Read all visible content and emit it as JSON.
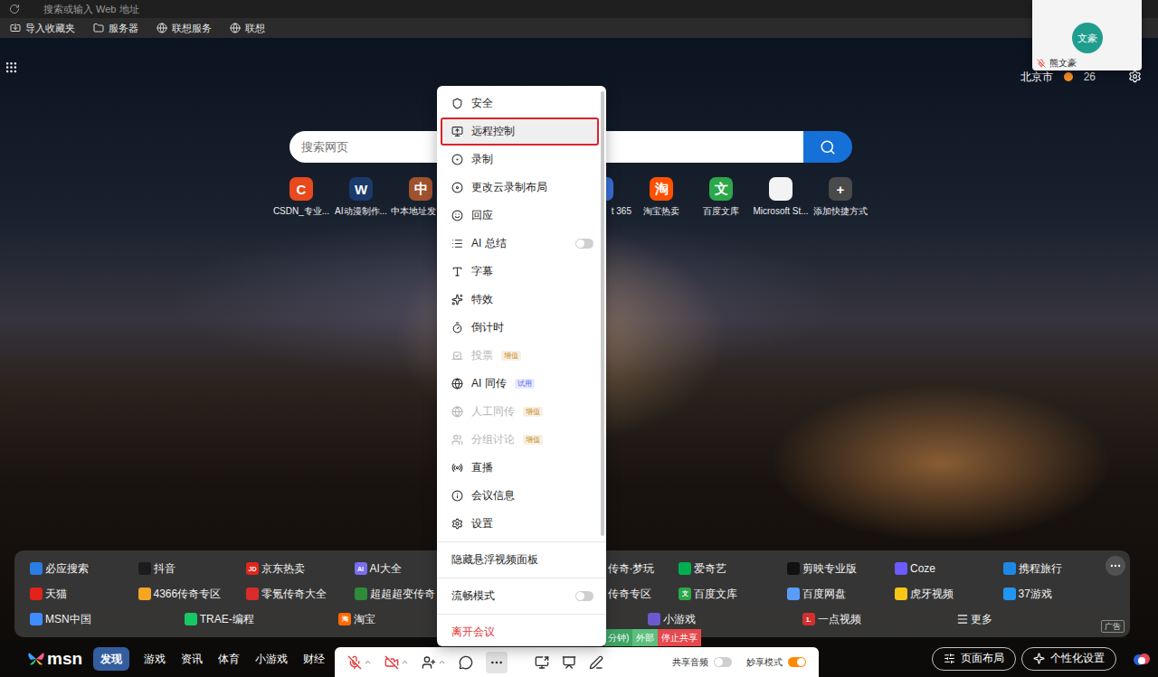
{
  "browser": {
    "address_placeholder": "搜索或输入 Web 地址",
    "bookmarks": [
      {
        "label": "导入收藏夹"
      },
      {
        "label": "服务器"
      },
      {
        "label": "联想服务"
      },
      {
        "label": "联想"
      }
    ]
  },
  "weather": {
    "city": "北京市",
    "temperature": "26"
  },
  "search": {
    "placeholder": "搜索网页"
  },
  "shortcuts": {
    "left": [
      {
        "label": "CSDN_专业...",
        "glyph": "C",
        "color": "#e8491d",
        "kind": "full"
      },
      {
        "label": "AI动漫制作...",
        "glyph": "W",
        "color": "#1b3a6b",
        "kind": "full"
      },
      {
        "label": "中本地址发",
        "glyph": "中",
        "color": "#a0522d",
        "kind": "cut-right"
      }
    ],
    "right": [
      {
        "label": "t 365",
        "glyph": "",
        "color": "#3a6fd8",
        "kind": "cut-left"
      },
      {
        "label": "淘宝热卖",
        "glyph": "淘",
        "color": "#ff5000",
        "kind": "full"
      },
      {
        "label": "百度文库",
        "glyph": "文",
        "color": "#2ba84a",
        "kind": "full"
      },
      {
        "label": "Microsoft St...",
        "glyph": "",
        "color": "#f3f3f3",
        "kind": "full"
      },
      {
        "label": "添加快捷方式",
        "glyph": "+",
        "color": "#4a4a4a",
        "kind": "full"
      }
    ]
  },
  "links": {
    "rows": [
      {
        "left": [
          {
            "label": "必应搜索",
            "glyph": "",
            "color": "#2a7de1",
            "kind": "app"
          },
          {
            "label": "抖音",
            "glyph": "",
            "color": "#1c1c1c",
            "kind": "app"
          },
          {
            "label": "京东热卖",
            "glyph": "JD",
            "color": "#e1251b",
            "kind": "app"
          },
          {
            "label": "AI大全",
            "glyph": "AI",
            "color": "#7a6df2",
            "kind": "app"
          }
        ],
        "right": [
          {
            "label": "传奇·梦玩",
            "kind": "cut"
          },
          {
            "label": "爱奇艺",
            "glyph": "",
            "color": "#00b050",
            "kind": "app"
          },
          {
            "label": "剪映专业版",
            "glyph": "",
            "color": "#111111",
            "kind": "app"
          },
          {
            "label": "Coze",
            "glyph": "",
            "color": "#6b5cff",
            "kind": "app"
          },
          {
            "label": "携程旅行",
            "glyph": "",
            "color": "#1e88e5",
            "kind": "app"
          }
        ]
      },
      {
        "left": [
          {
            "label": "天猫",
            "glyph": "",
            "color": "#e2231a",
            "kind": "app"
          },
          {
            "label": "4366传奇专区",
            "glyph": "",
            "color": "#f5a623",
            "kind": "app"
          },
          {
            "label": "零氪传奇大全",
            "glyph": "",
            "color": "#d92b2b",
            "kind": "app"
          },
          {
            "label": "超超超变传奇",
            "glyph": "",
            "color": "#2e8b3a",
            "kind": "app"
          }
        ],
        "right": [
          {
            "label": "传奇专区",
            "kind": "cut"
          },
          {
            "label": "百度文库",
            "glyph": "文",
            "color": "#2ba84a",
            "kind": "app"
          },
          {
            "label": "百度网盘",
            "glyph": "",
            "color": "#5a9cf8",
            "kind": "app"
          },
          {
            "label": "虎牙视频",
            "glyph": "",
            "color": "#f5c518",
            "kind": "app"
          },
          {
            "label": "37游戏",
            "glyph": "",
            "color": "#2196f3",
            "kind": "app"
          }
        ]
      },
      {
        "left": [
          {
            "label": "MSN中国",
            "glyph": "",
            "color": "#3f8cff",
            "kind": "app"
          },
          {
            "label": "TRAE-编程",
            "glyph": "",
            "color": "#17c964",
            "kind": "app"
          },
          {
            "label": "淘宝",
            "glyph": "淘",
            "color": "#ff6a00",
            "kind": "app"
          }
        ],
        "right": [
          {
            "label": "小游戏",
            "glyph": "",
            "color": "#6a5acd",
            "kind": "app"
          },
          {
            "label": "一点视频",
            "glyph": "1.",
            "color": "#d32f2f",
            "kind": "app"
          },
          {
            "label": "更多",
            "kind": "more"
          }
        ]
      }
    ],
    "ad_label": "广告"
  },
  "nav": {
    "logo": "msn",
    "items": [
      {
        "label": "发现",
        "selected": true
      },
      {
        "label": "游戏",
        "selected": false
      },
      {
        "label": "资讯",
        "selected": false
      },
      {
        "label": "体育",
        "selected": false
      },
      {
        "label": "小游戏",
        "selected": false
      },
      {
        "label": "财经",
        "selected": false
      }
    ],
    "buttons": [
      {
        "label": "页面布局"
      },
      {
        "label": "个性化设置"
      }
    ]
  },
  "video_panel": {
    "avatar": "文豪",
    "name": "熊文豪",
    "mic_muted": true
  },
  "menu": {
    "sections": [
      [
        {
          "label": "安全",
          "kind": "item",
          "selected": false,
          "disabled": false
        },
        {
          "label": "远程控制",
          "kind": "item",
          "selected": true,
          "disabled": false
        },
        {
          "label": "录制",
          "kind": "item",
          "selected": false,
          "disabled": false
        },
        {
          "label": "更改云录制布局",
          "kind": "item",
          "selected": false,
          "disabled": false
        },
        {
          "label": "回应",
          "kind": "item",
          "selected": false,
          "disabled": false
        },
        {
          "label": "AI 总结",
          "kind": "toggle",
          "selected": false,
          "disabled": false,
          "on": false
        },
        {
          "label": "字幕",
          "kind": "item",
          "selected": false,
          "disabled": false
        },
        {
          "label": "特效",
          "kind": "item",
          "selected": false,
          "disabled": false
        },
        {
          "label": "倒计时",
          "kind": "item",
          "selected": false,
          "disabled": false
        },
        {
          "label": "投票",
          "kind": "item",
          "selected": false,
          "disabled": true,
          "badge": "增值",
          "badge_color": "#c8912a"
        },
        {
          "label": "AI 同传",
          "kind": "item",
          "selected": false,
          "disabled": false,
          "badge": "试用",
          "badge_color": "#5865f2"
        },
        {
          "label": "人工同传",
          "kind": "item",
          "selected": false,
          "disabled": true,
          "badge": "增值",
          "badge_color": "#c8912a"
        },
        {
          "label": "分组讨论",
          "kind": "item",
          "selected": false,
          "disabled": true,
          "badge": "增值",
          "badge_color": "#c8912a"
        },
        {
          "label": "直播",
          "kind": "item",
          "selected": false,
          "disabled": false
        },
        {
          "label": "会议信息",
          "kind": "item",
          "selected": false,
          "disabled": false
        },
        {
          "label": "设置",
          "kind": "item",
          "selected": false,
          "disabled": false
        }
      ],
      [
        {
          "label": "隐藏悬浮视频面板",
          "kind": "item",
          "selected": false,
          "disabled": false
        }
      ],
      [
        {
          "label": "流畅模式",
          "kind": "toggle",
          "selected": false,
          "disabled": false,
          "on": false
        }
      ],
      [
        {
          "label": "离开会议",
          "kind": "danger",
          "selected": false,
          "disabled": false
        }
      ]
    ]
  },
  "share_status": {
    "duration": "分钟)",
    "scope": "外部",
    "stop": "停止共享"
  },
  "toolbar": {
    "mic_muted": true,
    "camera_off": true,
    "more_selected": true,
    "switches": [
      {
        "label": "共享音频",
        "on": false
      },
      {
        "label": "妙享模式",
        "on": true
      }
    ]
  }
}
